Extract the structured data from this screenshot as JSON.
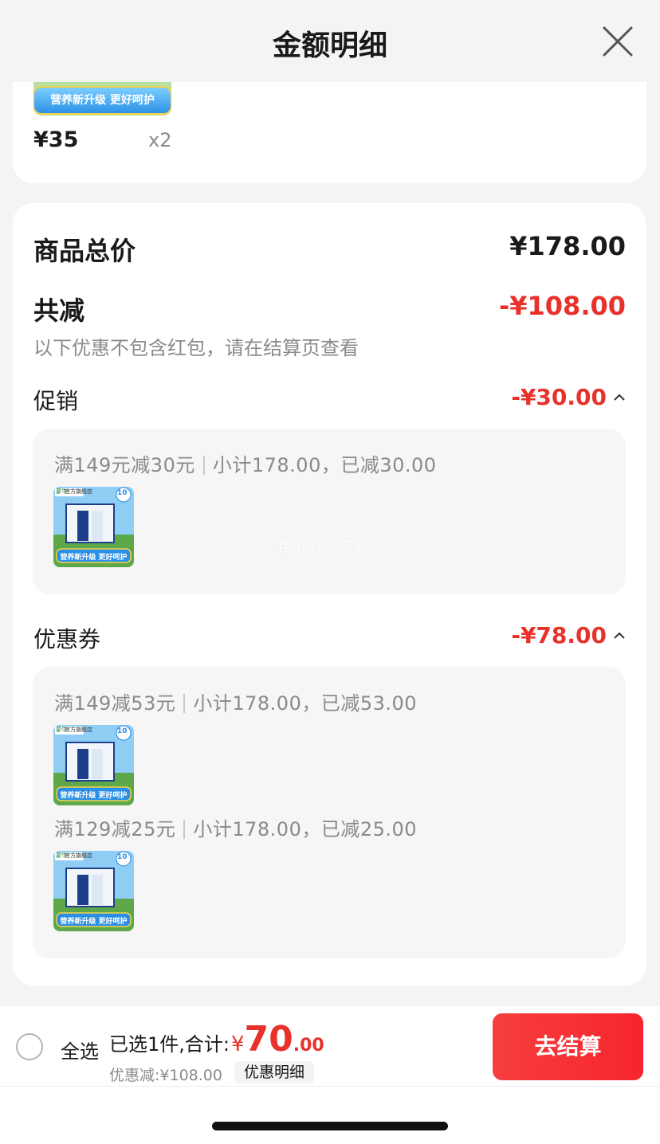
{
  "header": {
    "title": "金额明细"
  },
  "product": {
    "price": "¥35",
    "quantity": "x2",
    "banner_text": "营养新升级 更好呵护"
  },
  "summary": {
    "total_label": "商品总价",
    "total_value": "¥178.00",
    "reduce_label": "共减",
    "reduce_value": "-¥108.00",
    "reduce_note": "以下优惠不包含红包，请在结算页查看"
  },
  "promotion": {
    "label": "促销",
    "value": "-¥30.00",
    "rules": [
      {
        "condition": "满149元减30元",
        "detail": "小计178.00，已减30.00"
      }
    ]
  },
  "coupon": {
    "label": "优惠券",
    "value": "-¥78.00",
    "rules": [
      {
        "condition": "满149减53元",
        "detail": "小计178.00，已减53.00"
      },
      {
        "condition": "满129减25元",
        "detail": "小计178.00，已减25.00"
      }
    ]
  },
  "thumb": {
    "brand": "蒙牛",
    "store": "官方旗舰店",
    "badge": "10",
    "slogan": "营养新升级 更好呵护"
  },
  "watermark": "鱼的记忆秒",
  "bottom_bar": {
    "select_all": "全选",
    "selected_text": "已选1件,合计:",
    "currency": "¥",
    "total_int": "70",
    "total_dec": ".00",
    "discount_text": "优惠减:¥108.00",
    "detail_button": "优惠明细",
    "checkout_button": "去结算"
  },
  "colors": {
    "accent_red": "#e8312b",
    "checkout_red": "#f6252d"
  }
}
